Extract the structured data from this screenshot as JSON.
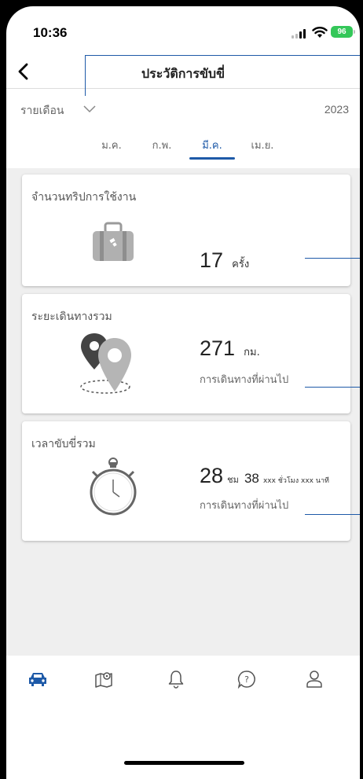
{
  "status": {
    "time": "10:36",
    "battery": "96"
  },
  "header": {
    "title": "ประวัติการขับขี่"
  },
  "filter": {
    "period": "รายเดือน",
    "year": "2023"
  },
  "months": [
    {
      "label": "ม.ค.",
      "active": false
    },
    {
      "label": "ก.พ.",
      "active": false
    },
    {
      "label": "มี.ค.",
      "active": true
    },
    {
      "label": "เม.ย.",
      "active": false
    }
  ],
  "cards": {
    "trips": {
      "title": "จำนวนทริปการใช้งาน",
      "value": "17",
      "unit": "ครั้ง"
    },
    "distance": {
      "title": "ระยะเดินทางรวม",
      "value": "271",
      "unit": "กม.",
      "caption": "การเดินทางที่ผ่านไป"
    },
    "time": {
      "title": "เวลาขับขี่รวม",
      "value": "28",
      "hours_unit": "ชม",
      "minutes": "38",
      "note": "xxx ชั่วโมง xxx นาที",
      "caption": "การเดินทางที่ผ่านไป"
    }
  },
  "nav": [
    {
      "icon": "car-icon",
      "active": true
    },
    {
      "icon": "map-pin-icon",
      "active": false
    },
    {
      "icon": "bell-icon",
      "active": false
    },
    {
      "icon": "help-icon",
      "active": false
    },
    {
      "icon": "profile-icon",
      "active": false
    }
  ],
  "colors": {
    "accent": "#1e5aa8",
    "background": "#efefef",
    "battery": "#34c759"
  }
}
